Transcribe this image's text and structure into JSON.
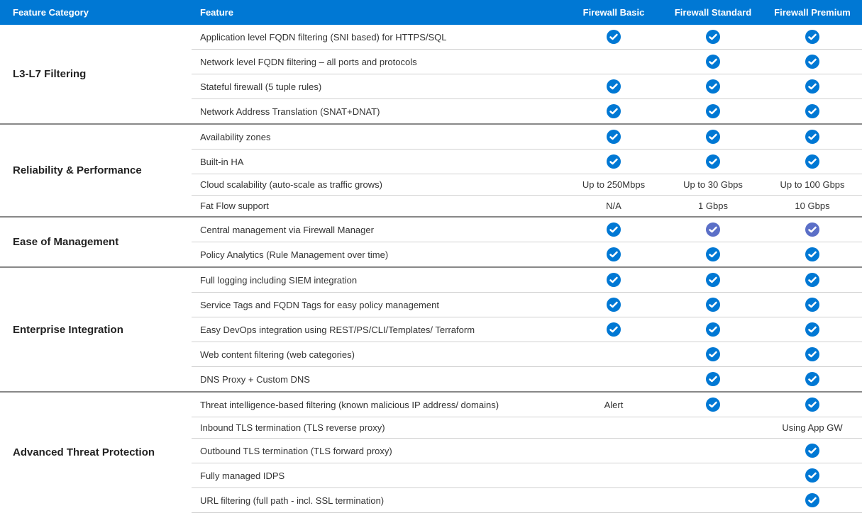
{
  "headers": {
    "category": "Feature Category",
    "feature": "Feature",
    "plans": [
      "Firewall Basic",
      "Firewall Standard",
      "Firewall Premium"
    ]
  },
  "groups": [
    {
      "category": "L3-L7 Filtering",
      "rows": [
        {
          "feature": "Application level FQDN filtering (SNI based) for HTTPS/SQL",
          "values": [
            "check",
            "check",
            "check"
          ]
        },
        {
          "feature": "Network level FQDN filtering – all ports and protocols",
          "values": [
            "",
            "check",
            "check"
          ]
        },
        {
          "feature": "Stateful firewall (5 tuple rules)",
          "values": [
            "check",
            "check",
            "check"
          ]
        },
        {
          "feature": "Network Address Translation (SNAT+DNAT)",
          "values": [
            "check",
            "check",
            "check"
          ]
        }
      ]
    },
    {
      "category": "Reliability & Performance",
      "rows": [
        {
          "feature": "Availability zones",
          "values": [
            "check",
            "check",
            "check"
          ]
        },
        {
          "feature": "Built-in  HA",
          "values": [
            "check",
            "check",
            "check"
          ]
        },
        {
          "feature": "Cloud scalability (auto-scale as traffic grows)",
          "values": [
            "Up to 250Mbps",
            "Up to 30 Gbps",
            "Up to 100 Gbps"
          ]
        },
        {
          "feature": " Fat Flow support",
          "values": [
            "N/A",
            "1 Gbps",
            "10 Gbps"
          ]
        }
      ]
    },
    {
      "category": "Ease of Management",
      "rows": [
        {
          "feature": "Central management via Firewall Manager",
          "values": [
            "check",
            "check-alt",
            "check-alt"
          ]
        },
        {
          "feature": "Policy Analytics (Rule Management over time)",
          "values": [
            "check",
            "check",
            "check"
          ]
        }
      ]
    },
    {
      "category": "Enterprise Integration",
      "rows": [
        {
          "feature": "Full logging including SIEM integration",
          "values": [
            "check",
            "check",
            "check"
          ]
        },
        {
          "feature": "Service Tags and FQDN Tags for easy policy management",
          "values": [
            "check",
            "check",
            "check"
          ]
        },
        {
          "feature": "Easy DevOps integration using REST/PS/CLI/Templates/ Terraform",
          "values": [
            "check",
            "check",
            "check"
          ]
        },
        {
          "feature": "Web content filtering (web categories)",
          "values": [
            "",
            "check",
            "check"
          ]
        },
        {
          "feature": "DNS Proxy + Custom DNS",
          "values": [
            "",
            "check",
            "check"
          ]
        }
      ]
    },
    {
      "category": "Advanced Threat Protection",
      "rows": [
        {
          "feature": "Threat intelligence-based filtering (known malicious IP address/ domains)",
          "values": [
            "Alert",
            "check",
            "check"
          ]
        },
        {
          "feature": "Inbound TLS termination (TLS reverse proxy)",
          "values": [
            "",
            "",
            "Using App GW"
          ]
        },
        {
          "feature": "Outbound TLS termination (TLS forward proxy)",
          "values": [
            "",
            "",
            "check"
          ]
        },
        {
          "feature": "Fully managed IDPS",
          "values": [
            "",
            "",
            "check"
          ]
        },
        {
          "feature": "URL filtering (full path - incl. SSL termination)",
          "values": [
            "",
            "",
            "check"
          ]
        }
      ]
    }
  ]
}
